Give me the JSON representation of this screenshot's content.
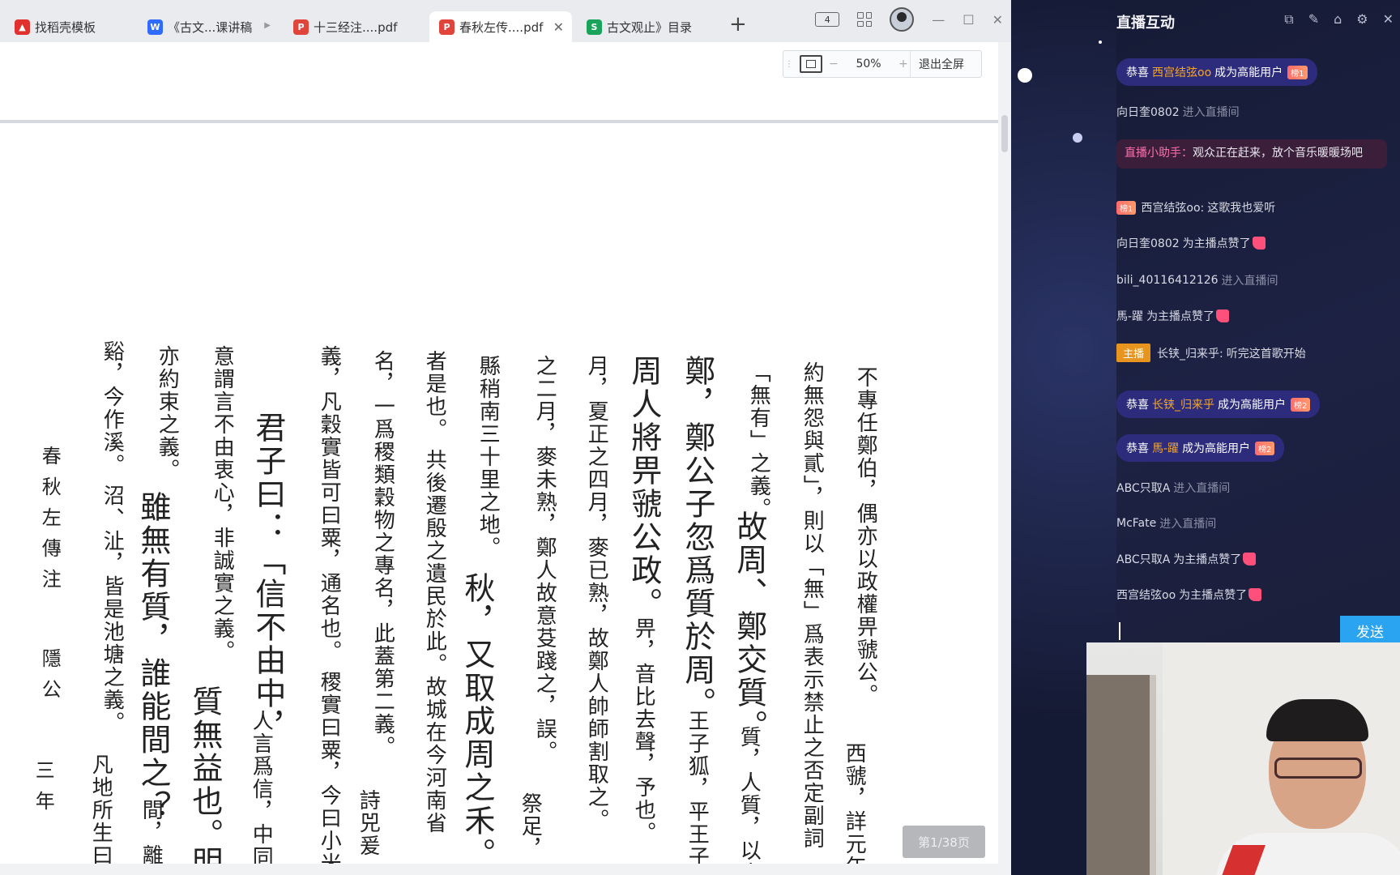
{
  "tabs": [
    {
      "label": "找稻壳模板",
      "icon": "docer-icon",
      "color": "#e0312f"
    },
    {
      "label": "《古文...课讲稿",
      "icon": "wps-writer-icon",
      "color": "#2f6bff"
    },
    {
      "label": "十三经注....pdf",
      "icon": "pdf-icon",
      "color": "#e0443a"
    },
    {
      "label": "春秋左传....pdf",
      "icon": "pdf-icon",
      "color": "#e0443a",
      "active": true
    },
    {
      "label": "古文观止》目录",
      "icon": "wps-sheet-icon",
      "color": "#1aa35a"
    }
  ],
  "titlebar": {
    "page_indicator": "4"
  },
  "zoom": {
    "value": "50%",
    "exit_fullscreen": "退出全屏"
  },
  "page_number": "第1/38页",
  "document": {
    "header": "春秋左傳注",
    "header2": "隱公",
    "header3": "三年",
    "columns": [
      {
        "text": "不專任鄭伯，偶亦以政權畀虢公。",
        "size": "sm"
      },
      {
        "text": "西虢，詳元年",
        "size": "sm"
      },
      {
        "text": "約無怨與貳」，則以「無」爲表示禁止之否定副詞",
        "size": "sm"
      },
      {
        "text": "「無有」之義。",
        "size": "sm"
      },
      {
        "text": "故周、鄭交質。",
        "size": "lg"
      },
      {
        "text": "質，人質，以人",
        "size": "sm"
      },
      {
        "text": "鄭，鄭公子忽爲質於周。",
        "size": "lg"
      },
      {
        "text": "王子狐，平王子",
        "size": "sm"
      },
      {
        "text": "周人將畀虢公政。",
        "size": "lg"
      },
      {
        "text": "畀，音比去聲，予也。",
        "size": "sm"
      },
      {
        "text": "月，夏正之四月，麥已熟，故鄭人帥師割取之。",
        "size": "sm"
      },
      {
        "text": "之二月，麥未熟，鄭人故意芟踐之，誤。",
        "size": "sm"
      },
      {
        "text": "祭足，",
        "size": "sm"
      },
      {
        "text": "縣稍南三十里之地。",
        "size": "sm"
      },
      {
        "text": "秋，又取成周之禾。",
        "size": "lg"
      },
      {
        "text": "者是也。 共後遷殷之遺民於此。故城在今河南省",
        "size": "sm"
      },
      {
        "text": "名，一爲稷類穀物之專名，此蓋第二義。",
        "size": "sm"
      },
      {
        "text": "詩兕爰",
        "size": "sm"
      },
      {
        "text": "義，凡穀實皆可曰粟，通名也。 稷實曰粟，今曰小米",
        "size": "sm"
      },
      {
        "text": "君子曰：「信不由中，",
        "size": "lg"
      },
      {
        "text": "人言爲信，中同",
        "size": "sm"
      },
      {
        "text": "意謂言不由衷心，非誠實之義。",
        "size": "sm"
      },
      {
        "text": "質無益也。",
        "size": "lg"
      },
      {
        "text": "明",
        "size": "lg"
      },
      {
        "text": "亦約束之義。",
        "size": "sm"
      },
      {
        "text": "雖無有質，誰能間之？",
        "size": "lg"
      },
      {
        "text": "間，離",
        "size": "sm"
      },
      {
        "text": "谿，今作溪。 沼、沚，皆是池塘之義。",
        "size": "sm"
      },
      {
        "text": "凡地所生曰",
        "size": "sm"
      }
    ]
  },
  "live": {
    "title": "直播互动",
    "send": "发送",
    "messages": [
      {
        "type": "upgrade",
        "prefix": "恭喜",
        "who": "西宫结弦oo",
        "text": "成为高能用户",
        "badge": "榜1"
      },
      {
        "type": "enter",
        "who": "向日奎0802",
        "text": "进入直播间"
      },
      {
        "type": "helper",
        "who": "直播小助手：",
        "text": "观众正在赶来，放个音乐暖暖场吧"
      },
      {
        "type": "chat",
        "badge": "榜1",
        "who": "西宫结弦oo:",
        "text": "这歌我也爱听"
      },
      {
        "type": "like",
        "who": "向日奎0802",
        "text": "为主播点赞了"
      },
      {
        "type": "enter",
        "who": "bili_40116412126",
        "text": "进入直播间"
      },
      {
        "type": "like",
        "who": "馬-躍",
        "text": "为主播点赞了"
      },
      {
        "type": "host",
        "badge": "主播",
        "who": "长铗_归来乎:",
        "text": "听完这首歌开始"
      },
      {
        "type": "upgrade",
        "prefix": "恭喜",
        "who": "长铗_归来乎",
        "text": "成为高能用户",
        "badge": "榜2"
      },
      {
        "type": "upgrade",
        "prefix": "恭喜",
        "who": "馬-躍",
        "text": "成为高能用户",
        "badge": "榜2"
      },
      {
        "type": "enter",
        "who": "ABC只取A",
        "text": "进入直播间"
      },
      {
        "type": "enter",
        "who": "McFate",
        "text": "进入直播间"
      },
      {
        "type": "like",
        "who": "ABC只取A",
        "text": "为主播点赞了"
      },
      {
        "type": "like",
        "who": "西宫结弦oo",
        "text": "为主播点赞了"
      }
    ]
  }
}
